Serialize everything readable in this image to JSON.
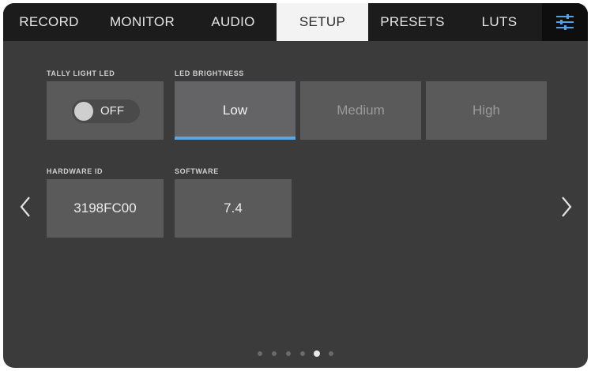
{
  "tabs": [
    {
      "label": "RECORD",
      "active": false
    },
    {
      "label": "MONITOR",
      "active": false
    },
    {
      "label": "AUDIO",
      "active": false
    },
    {
      "label": "SETUP",
      "active": true
    },
    {
      "label": "PRESETS",
      "active": false
    },
    {
      "label": "LUTS",
      "active": false
    }
  ],
  "menu_icon": "sliders-icon",
  "tally": {
    "label": "TALLY LIGHT LED",
    "state": "OFF"
  },
  "brightness": {
    "label": "LED BRIGHTNESS",
    "options": [
      "Low",
      "Medium",
      "High"
    ],
    "selected": "Low"
  },
  "hardware": {
    "label": "HARDWARE ID",
    "value": "3198FC00"
  },
  "software": {
    "label": "SOFTWARE",
    "value": "7.4"
  },
  "pagination": {
    "total": 6,
    "current": 5
  },
  "colors": {
    "accent": "#55a9ea",
    "background": "#3b3b3c",
    "tabbar": "#1c1c1d"
  }
}
